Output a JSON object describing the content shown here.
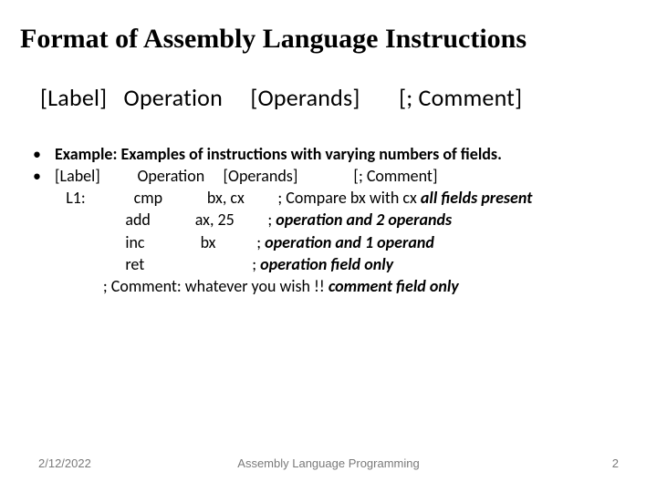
{
  "title": "Format of Assembly Language Instructions",
  "syntax": {
    "label": "[Label]",
    "operation": "Operation",
    "operands": "[Operands]",
    "comment": "[; Comment]"
  },
  "bullets": {
    "example_label": "Example:",
    "example_text": " Examples of instructions with varying numbers of fields.",
    "header": {
      "label": "[Label]",
      "operation": "Operation",
      "operands": "[Operands]",
      "comment": "[; Comment]"
    },
    "rows": [
      {
        "label": "   L1:",
        "op": "cmp",
        "args": "bx, cx",
        "note_plain": "; Compare bx with cx ",
        "note_bold_italic": "all fields present"
      },
      {
        "label": "",
        "op": "add",
        "args": "ax, 25",
        "note_plain": "; ",
        "note_bold_italic": "operation and 2 operands"
      },
      {
        "label": "",
        "op": "inc",
        "args": " bx",
        "note_plain": "; ",
        "note_bold_italic": "operation and 1 operand"
      },
      {
        "label": "",
        "op": "ret",
        "args": "",
        "note_plain": "; ",
        "note_bold_italic": "operation field only"
      }
    ],
    "comment_line_plain": "; Comment: whatever you wish !! ",
    "comment_line_bold_italic": "comment field only"
  },
  "footer": {
    "date": "2/12/2022",
    "center": "Assembly Language Programming",
    "page": "2"
  }
}
